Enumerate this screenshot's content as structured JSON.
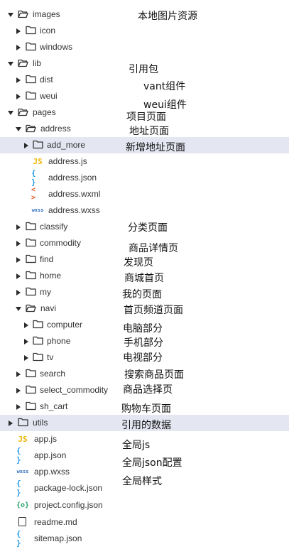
{
  "tree": {
    "images": "images",
    "icon": "icon",
    "windows": "windows",
    "lib": "lib",
    "dist": "dist",
    "weui": "weui",
    "pages": "pages",
    "address": "address",
    "add_more": "add_more",
    "address_js": "address.js",
    "address_json": "address.json",
    "address_wxml": "address.wxml",
    "address_wxss": "address.wxss",
    "classify": "classify",
    "commodity": "commodity",
    "find": "find",
    "home": "home",
    "my": "my",
    "navi": "navi",
    "computer": "computer",
    "phone": "phone",
    "tv": "tv",
    "search": "search",
    "select_commodity": "select_commodity",
    "sh_cart": "sh_cart",
    "utils": "utils",
    "app_js": "app.js",
    "app_json": "app.json",
    "app_wxss": "app.wxss",
    "package_lock": "package-lock.json",
    "project_config": "project.config.json",
    "readme": "readme.md",
    "sitemap": "sitemap.json"
  },
  "icons": {
    "js": "JS",
    "json": "{ }",
    "wxml": "< >",
    "wxss": "wxss",
    "config": "{o}"
  },
  "notes": {
    "images": "本地图片资源",
    "lib": "引用包",
    "vant": "vant组件",
    "weui": "weui组件",
    "pages": "项目页面",
    "address": "地址页面",
    "add_more": "新增地址页面",
    "classify": "分类页面",
    "commodity": "商品详情页",
    "find": "发现页",
    "home": "商城首页",
    "my": "我的页面",
    "navi": "首页频道页面",
    "computer": "电脑部分",
    "phone": "手机部分",
    "tv": "电视部分",
    "search": "搜索商品页面",
    "select_commodity": "商品选择页",
    "sh_cart": "购物车页面",
    "utils": "引用的数据",
    "app_js": "全局js",
    "app_json": "全局json配置",
    "app_wxss": "全局样式"
  },
  "colors": {
    "selected_row": "#e4e6f1",
    "js": "#f0b400",
    "json": "#2a9de8",
    "wxml": "#e35a24",
    "wxss": "#2f6fbf",
    "config": "#2aa36b"
  }
}
